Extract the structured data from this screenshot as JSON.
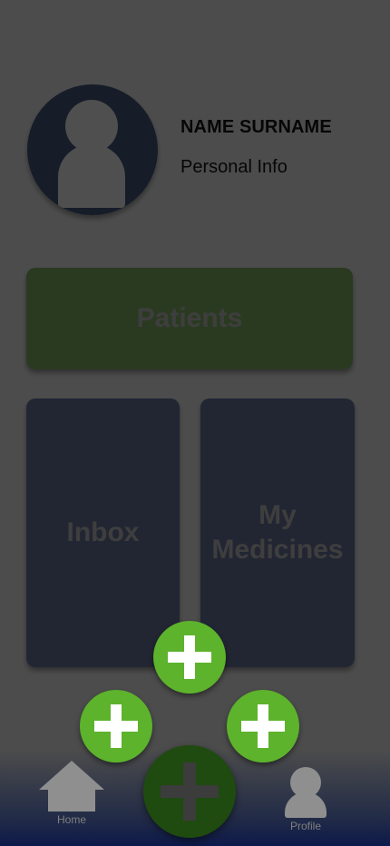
{
  "profile": {
    "name": "NAME SURNAME",
    "info": "Personal Info",
    "avatar_icon": "person-silhouette-icon"
  },
  "cards": {
    "patients": "Patients",
    "inbox": "Inbox",
    "medicines": "My Medicines"
  },
  "floating_actions": {
    "icon": "plus-icon",
    "count_small": 3,
    "main_icon": "plus-icon"
  },
  "bottom_nav": {
    "home": {
      "label": "Home",
      "icon": "home-icon"
    },
    "profile": {
      "label": "Profile",
      "icon": "person-icon"
    }
  },
  "colors": {
    "card_green": "#6f9a58",
    "card_blue": "#5a6486",
    "plus_green": "#5db32c",
    "main_fab": "#1f4a10",
    "nav_bottom": "#0d1a4a"
  }
}
